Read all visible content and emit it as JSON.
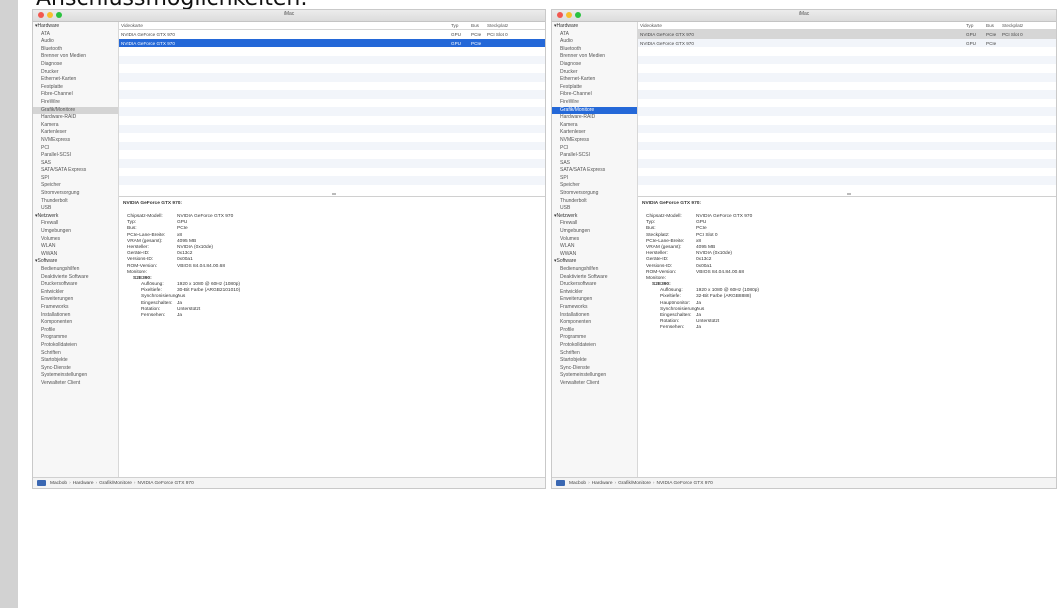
{
  "caption": "Anschlussmöglichkeiten:",
  "window_title": "iMac",
  "sidebar": [
    {
      "label": "Hardware",
      "group": true
    },
    {
      "label": "ATA"
    },
    {
      "label": "Audio"
    },
    {
      "label": "Bluetooth"
    },
    {
      "label": "Brenner von Medien"
    },
    {
      "label": "Diagnose"
    },
    {
      "label": "Drucker"
    },
    {
      "label": "Ethernet-Karten"
    },
    {
      "label": "Festplatte"
    },
    {
      "label": "Fibre-Channel"
    },
    {
      "label": "FireWire"
    },
    {
      "label": "Grafik/Monitore",
      "selected": true
    },
    {
      "label": "Hardware-RAID"
    },
    {
      "label": "Kamera"
    },
    {
      "label": "Kartenleser"
    },
    {
      "label": "NVMExpress"
    },
    {
      "label": "PCI"
    },
    {
      "label": "Parallel-SCSI"
    },
    {
      "label": "SAS"
    },
    {
      "label": "SATA/SATA Express"
    },
    {
      "label": "SPI"
    },
    {
      "label": "Speicher"
    },
    {
      "label": "Stromversorgung"
    },
    {
      "label": "Thunderbolt"
    },
    {
      "label": "USB"
    },
    {
      "label": "Netzwerk",
      "group": true
    },
    {
      "label": "Firewall"
    },
    {
      "label": "Umgebungen"
    },
    {
      "label": "Volumes"
    },
    {
      "label": "WLAN"
    },
    {
      "label": "WWAN"
    },
    {
      "label": "Software",
      "group": true
    },
    {
      "label": "Bedienungshilfen"
    },
    {
      "label": "Deaktivierte Software"
    },
    {
      "label": "Druckersoftware"
    },
    {
      "label": "Entwickler"
    },
    {
      "label": "Erweiterungen"
    },
    {
      "label": "Frameworks"
    },
    {
      "label": "Installationen"
    },
    {
      "label": "Komponenten"
    },
    {
      "label": "Profile"
    },
    {
      "label": "Programme"
    },
    {
      "label": "Protokolldateien"
    },
    {
      "label": "Schriften"
    },
    {
      "label": "Startobjekte"
    },
    {
      "label": "Sync-Dienste"
    },
    {
      "label": "Systemeinstellungen"
    },
    {
      "label": "Verwalteter Client"
    }
  ],
  "table": {
    "columns": [
      "Videokarte",
      "Typ",
      "Bus",
      "Steckplatz"
    ],
    "rows": [
      {
        "name": "NVIDIA GeForce GTX 970",
        "typ": "GPU",
        "bus": "PCIe",
        "slot": "PCI Slot 0"
      },
      {
        "name": "NVIDIA GeForce GTX 970",
        "typ": "GPU",
        "bus": "PCIe",
        "slot": ""
      }
    ]
  },
  "detail": {
    "title": "NVIDIA GeForce GTX 970:",
    "left": [
      {
        "k": "Chipsatz-Modell:",
        "v": "NVIDIA GeForce GTX 970",
        "lvl": 0
      },
      {
        "k": "Typ:",
        "v": "GPU",
        "lvl": 0
      },
      {
        "k": "Bus:",
        "v": "PCIe",
        "lvl": 0
      },
      {
        "k": "PCIe-Lane-Breite:",
        "v": "x8",
        "lvl": 0
      },
      {
        "k": "VRAM (gesamt):",
        "v": "4095 MB",
        "lvl": 0
      },
      {
        "k": "Hersteller:",
        "v": "NVIDIA (0x10de)",
        "lvl": 0
      },
      {
        "k": "Geräte-ID:",
        "v": "0x13c2",
        "lvl": 0
      },
      {
        "k": "Versions-ID:",
        "v": "0x00a1",
        "lvl": 0
      },
      {
        "k": "ROM-Version:",
        "v": "VBIOS 84.04.84.00.68",
        "lvl": 0
      },
      {
        "k": "Monitore:",
        "v": "",
        "lvl": 0
      },
      {
        "k": "S2E390:",
        "v": "",
        "lvl": 1,
        "head": true
      },
      {
        "k": "Auflösung:",
        "v": "1920 x 1080 @ 60Hz (1080p)",
        "lvl": 2
      },
      {
        "k": "Pixeltiefe:",
        "v": "30-Bit Farbe (ARGB2101010)",
        "lvl": 2
      },
      {
        "k": "Synchronisierung:",
        "v": "Aus",
        "lvl": 2
      },
      {
        "k": "Eingeschalten:",
        "v": "Ja",
        "lvl": 2
      },
      {
        "k": "Rotation:",
        "v": "Unterstützt",
        "lvl": 2
      },
      {
        "k": "Fernsehen:",
        "v": "Ja",
        "lvl": 2
      }
    ],
    "right": [
      {
        "k": "Chipsatz-Modell:",
        "v": "NVIDIA GeForce GTX 970",
        "lvl": 0
      },
      {
        "k": "Typ:",
        "v": "GPU",
        "lvl": 0
      },
      {
        "k": "Bus:",
        "v": "PCIe",
        "lvl": 0
      },
      {
        "k": "Steckplatz:",
        "v": "PCI Slot 0",
        "lvl": 0
      },
      {
        "k": "PCIe-Lane-Breite:",
        "v": "x8",
        "lvl": 0
      },
      {
        "k": "VRAM (gesamt):",
        "v": "4095 MB",
        "lvl": 0
      },
      {
        "k": "Hersteller:",
        "v": "NVIDIA (0x10de)",
        "lvl": 0
      },
      {
        "k": "Geräte-ID:",
        "v": "0x13c2",
        "lvl": 0
      },
      {
        "k": "Versions-ID:",
        "v": "0x00a1",
        "lvl": 0
      },
      {
        "k": "ROM-Version:",
        "v": "VBIOS 84.04.84.00.68",
        "lvl": 0
      },
      {
        "k": "Monitore:",
        "v": "",
        "lvl": 0
      },
      {
        "k": "S2E390:",
        "v": "",
        "lvl": 1,
        "head": true
      },
      {
        "k": "Auflösung:",
        "v": "1920 x 1080 @ 60Hz (1080p)",
        "lvl": 2
      },
      {
        "k": "Pixeltiefe:",
        "v": "32-Bit Farbe (ARGB8888)",
        "lvl": 2
      },
      {
        "k": "Hauptmonitor:",
        "v": "Ja",
        "lvl": 2
      },
      {
        "k": "Synchronisierung:",
        "v": "Aus",
        "lvl": 2
      },
      {
        "k": "Eingeschalten:",
        "v": "Ja",
        "lvl": 2
      },
      {
        "k": "Rotation:",
        "v": "Unterstützt",
        "lvl": 2
      },
      {
        "k": "Fernsehen:",
        "v": "Ja",
        "lvl": 2
      }
    ]
  },
  "pathbar": [
    "Macbob",
    "Hardware",
    "Grafik/Monitore",
    "NVIDIA GeForce GTX 970"
  ],
  "pathbar_separator": "›",
  "colors": {
    "selection_blue": "#2468d8",
    "selection_gray": "#d4d4d4",
    "close": "#f2574f",
    "minimize": "#f7be2d",
    "zoom": "#2ac23f"
  }
}
